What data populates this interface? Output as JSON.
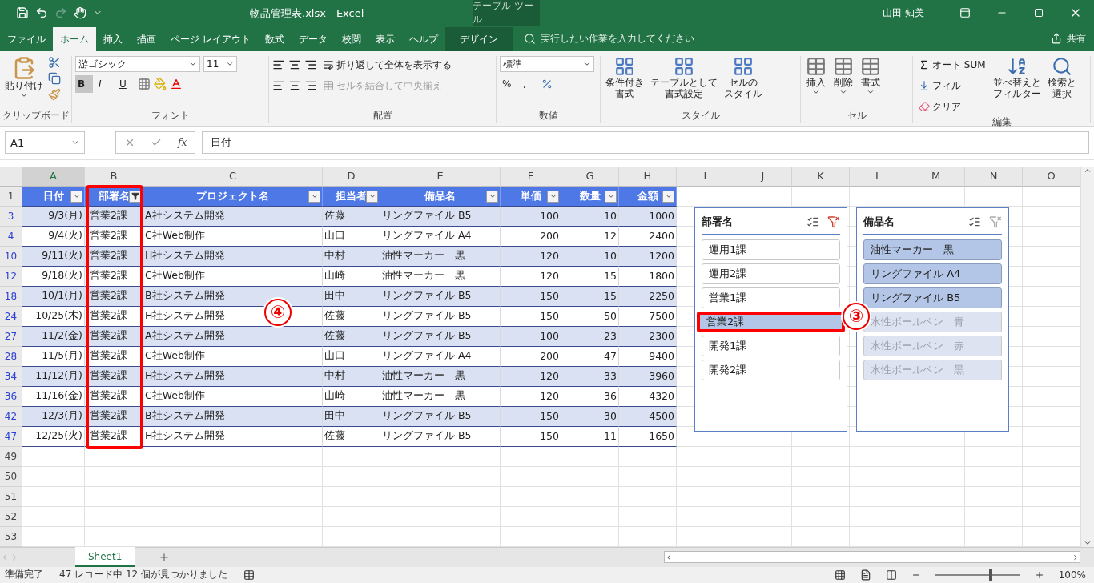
{
  "title_bar": {
    "filename": "物品管理表.xlsx",
    "separator": "-",
    "app": "Excel",
    "context_tab": "テーブル ツール",
    "user": "山田 知美"
  },
  "ribbon_tabs": [
    {
      "label": "ファイル",
      "selected": false,
      "kind": "normal"
    },
    {
      "label": "ホーム",
      "selected": true,
      "kind": "normal"
    },
    {
      "label": "挿入",
      "selected": false,
      "kind": "normal"
    },
    {
      "label": "描画",
      "selected": false,
      "kind": "normal"
    },
    {
      "label": "ページ レイアウト",
      "selected": false,
      "kind": "normal"
    },
    {
      "label": "数式",
      "selected": false,
      "kind": "normal"
    },
    {
      "label": "データ",
      "selected": false,
      "kind": "normal"
    },
    {
      "label": "校閲",
      "selected": false,
      "kind": "normal"
    },
    {
      "label": "表示",
      "selected": false,
      "kind": "normal"
    },
    {
      "label": "ヘルプ",
      "selected": false,
      "kind": "normal"
    },
    {
      "label": "デザイン",
      "selected": false,
      "kind": "context"
    }
  ],
  "tell_me": {
    "placeholder": "実行したい作業を入力してください"
  },
  "share": "共有",
  "ribbon": {
    "clipboard": {
      "paste": "貼り付け",
      "label": "クリップボード"
    },
    "font": {
      "name": "游ゴシック",
      "size": "11",
      "bold": "B",
      "italic": "I",
      "underline": "U",
      "label": "フォント"
    },
    "alignment": {
      "wrap": "折り返して全体を表示する",
      "merge": "セルを結合して中央揃え",
      "label": "配置"
    },
    "number": {
      "format": "標準",
      "percent": "%",
      "comma": ",",
      "label": "数値"
    },
    "styles": {
      "buttons": [
        [
          "条件付き",
          "書式"
        ],
        [
          "テーブルとして",
          "書式設定"
        ],
        [
          "セルの",
          "スタイル"
        ]
      ],
      "label": "スタイル"
    },
    "cells": {
      "buttons": [
        "挿入",
        "削除",
        "書式"
      ],
      "label": "セル"
    },
    "editing": {
      "autosum": "オート SUM",
      "fill": "フィル",
      "clear": "クリア",
      "buttons": [
        [
          "並べ替えと",
          "フィルター"
        ],
        [
          "検索と",
          "選択"
        ]
      ],
      "label": "編集"
    }
  },
  "formula_bar": {
    "name_box": "A1",
    "fx": "fx",
    "value": "日付"
  },
  "column_letters": [
    "A",
    "B",
    "C",
    "D",
    "E",
    "F",
    "G",
    "H",
    "I",
    "J",
    "K",
    "L",
    "M",
    "N",
    "O"
  ],
  "table": {
    "columns": [
      {
        "label": "日付",
        "filtered": false,
        "highlighted": false
      },
      {
        "label": "部署名",
        "filtered": true,
        "highlighted": true
      },
      {
        "label": "プロジェクト名",
        "filtered": false,
        "highlighted": false
      },
      {
        "label": "担当者",
        "filtered": false,
        "highlighted": false
      },
      {
        "label": "備品名",
        "filtered": false,
        "highlighted": false
      },
      {
        "label": "単価",
        "filtered": false,
        "highlighted": false
      },
      {
        "label": "数量",
        "filtered": false,
        "highlighted": false
      },
      {
        "label": "金額",
        "filtered": false,
        "highlighted": false
      }
    ],
    "header_row": "1",
    "rows": [
      {
        "row": "3",
        "cells": [
          "9/3(月)",
          "営業2課",
          "A社システム開発",
          "佐藤",
          "リングファイル B5",
          "100",
          "10",
          "1000"
        ]
      },
      {
        "row": "4",
        "cells": [
          "9/4(火)",
          "営業2課",
          "C社Web制作",
          "山口",
          "リングファイル A4",
          "200",
          "12",
          "2400"
        ]
      },
      {
        "row": "10",
        "cells": [
          "9/11(火)",
          "営業2課",
          "H社システム開発",
          "中村",
          "油性マーカー　黒",
          "120",
          "10",
          "1200"
        ]
      },
      {
        "row": "12",
        "cells": [
          "9/18(火)",
          "営業2課",
          "C社Web制作",
          "山崎",
          "油性マーカー　黒",
          "120",
          "15",
          "1800"
        ]
      },
      {
        "row": "18",
        "cells": [
          "10/1(月)",
          "営業2課",
          "B社システム開発",
          "田中",
          "リングファイル B5",
          "150",
          "15",
          "2250"
        ]
      },
      {
        "row": "24",
        "cells": [
          "10/25(木)",
          "営業2課",
          "H社システム開発",
          "佐藤",
          "リングファイル B5",
          "150",
          "50",
          "7500"
        ]
      },
      {
        "row": "27",
        "cells": [
          "11/2(金)",
          "営業2課",
          "A社システム開発",
          "佐藤",
          "リングファイル B5",
          "100",
          "23",
          "2300"
        ]
      },
      {
        "row": "28",
        "cells": [
          "11/5(月)",
          "営業2課",
          "C社Web制作",
          "山口",
          "リングファイル A4",
          "200",
          "47",
          "9400"
        ]
      },
      {
        "row": "34",
        "cells": [
          "11/12(月)",
          "営業2課",
          "H社システム開発",
          "中村",
          "油性マーカー　黒",
          "120",
          "33",
          "3960"
        ]
      },
      {
        "row": "36",
        "cells": [
          "11/16(金)",
          "営業2課",
          "C社Web制作",
          "山崎",
          "油性マーカー　黒",
          "120",
          "36",
          "4320"
        ]
      },
      {
        "row": "42",
        "cells": [
          "12/3(月)",
          "営業2課",
          "B社システム開発",
          "田中",
          "リングファイル B5",
          "150",
          "30",
          "4500"
        ]
      },
      {
        "row": "47",
        "cells": [
          "12/25(火)",
          "営業2課",
          "H社システム開発",
          "佐藤",
          "リングファイル B5",
          "150",
          "11",
          "1650"
        ]
      }
    ],
    "empty_rows": [
      "49",
      "50",
      "51",
      "52",
      "53"
    ]
  },
  "slicers": [
    {
      "title": "部署名",
      "filtered": true,
      "items": [
        {
          "label": "運用1課",
          "selected": false,
          "has_data": true,
          "highlighted": false
        },
        {
          "label": "運用2課",
          "selected": false,
          "has_data": true,
          "highlighted": false
        },
        {
          "label": "営業1課",
          "selected": false,
          "has_data": true,
          "highlighted": false
        },
        {
          "label": "営業2課",
          "selected": true,
          "has_data": true,
          "highlighted": true
        },
        {
          "label": "開発1課",
          "selected": false,
          "has_data": true,
          "highlighted": false
        },
        {
          "label": "開発2課",
          "selected": false,
          "has_data": true,
          "highlighted": false
        }
      ]
    },
    {
      "title": "備品名",
      "filtered": false,
      "items": [
        {
          "label": "油性マーカー　黒",
          "selected": true,
          "has_data": true,
          "highlighted": false
        },
        {
          "label": "リングファイル A4",
          "selected": true,
          "has_data": true,
          "highlighted": false
        },
        {
          "label": "リングファイル B5",
          "selected": true,
          "has_data": true,
          "highlighted": false
        },
        {
          "label": "水性ボールペン　青",
          "selected": false,
          "has_data": false,
          "highlighted": false
        },
        {
          "label": "水性ボールペン　赤",
          "selected": false,
          "has_data": false,
          "highlighted": false
        },
        {
          "label": "水性ボールペン　黒",
          "selected": false,
          "has_data": false,
          "highlighted": false
        }
      ]
    }
  ],
  "annotations": [
    "④",
    "③"
  ],
  "sheet_tabs": [
    {
      "label": "Sheet1",
      "selected": true
    }
  ],
  "status_bar": {
    "mode": "準備完了",
    "message": "47 レコード中 12 個が見つかりました",
    "zoom_slider": {
      "level": 0.65
    },
    "zoom": "100%"
  }
}
